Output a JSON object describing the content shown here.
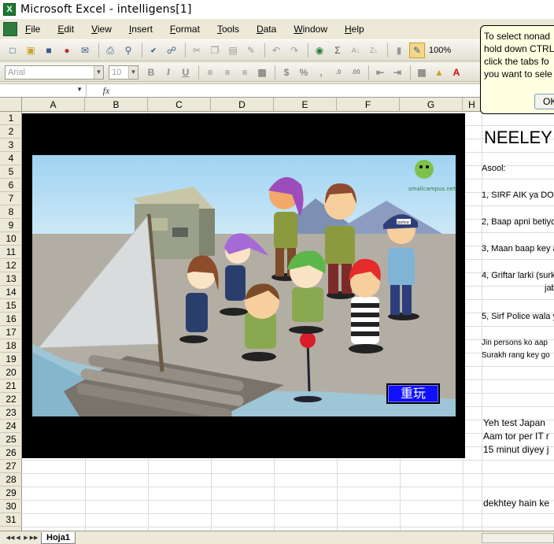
{
  "window": {
    "title": "Microsoft Excel - intelligens[1]",
    "app_icon_letter": "X"
  },
  "menu": {
    "items": [
      {
        "label": "File",
        "underline": "F",
        "rest": "ile"
      },
      {
        "label": "Edit",
        "underline": "E",
        "rest": "dit"
      },
      {
        "label": "View",
        "underline": "V",
        "rest": "iew"
      },
      {
        "label": "Insert",
        "underline": "I",
        "rest": "nsert"
      },
      {
        "label": "Format",
        "underline": "F",
        "rest": "ormat"
      },
      {
        "label": "Tools",
        "underline": "T",
        "rest": "ools"
      },
      {
        "label": "Data",
        "underline": "D",
        "rest": "ata"
      },
      {
        "label": "Window",
        "underline": "W",
        "rest": "indow"
      },
      {
        "label": "Help",
        "underline": "H",
        "rest": "elp"
      }
    ]
  },
  "toolbar": {
    "zoom": "100%"
  },
  "format_toolbar": {
    "font_name": "Arial",
    "font_size": "10"
  },
  "formula_bar": {
    "fx": "fx",
    "name_box": "",
    "content": ""
  },
  "columns": [
    "A",
    "B",
    "C",
    "D",
    "E",
    "F",
    "G",
    "H"
  ],
  "rows": [
    "1",
    "2",
    "3",
    "4",
    "5",
    "6",
    "7",
    "8",
    "9",
    "10",
    "11",
    "12",
    "13",
    "14",
    "15",
    "16",
    "17",
    "18",
    "19",
    "20",
    "21",
    "22",
    "23",
    "24",
    "25",
    "26",
    "27",
    "28",
    "29",
    "30",
    "31"
  ],
  "game": {
    "replay_label": "重玩",
    "logo_text": "smallcampus.net",
    "police_cap": "police"
  },
  "cells": {
    "title": "NEELEY",
    "asool": "Asool:",
    "rule1": "1, SIRF AIK ya DO",
    "rule2": "2, Baap apni betiyc",
    "rule3": "3, Maan baap key a",
    "rule4a": "4, Griftar larki (surk",
    "rule4b": "jab",
    "rule5": "5, Sirf Police wala y",
    "note1": "Jin persons ko aap",
    "note2": "Surakh rang key go",
    "line1": "Yeh test Japan",
    "line2": "Aam tor per IT r",
    "line3": "15 minut diyey j",
    "line4": "dekhtey hain ke"
  },
  "callout": {
    "lines": [
      "To select nonad",
      "hold down CTRL",
      "click the tabs fo",
      "you want to sele"
    ],
    "ok_label": "OK"
  },
  "sheets": [
    {
      "name": "Hoja1"
    }
  ]
}
